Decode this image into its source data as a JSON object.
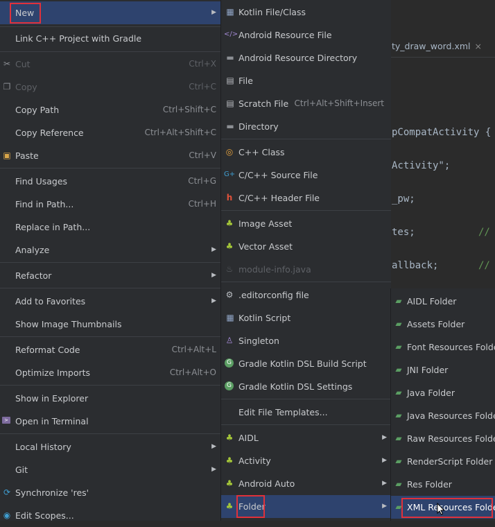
{
  "editor": {
    "tab": "ty_draw_word.xml",
    "tab_close": "×",
    "lines": [
      {
        "text": "pCompatActivity {",
        "comment": ""
      },
      {
        "text": "Activity\";",
        "comment": ""
      },
      {
        "text": "_pw;",
        "comment": ""
      },
      {
        "text": "tes;",
        "comment": "//"
      },
      {
        "text": "allback;",
        "comment": "//"
      }
    ]
  },
  "menu1": {
    "items": [
      {
        "label": "New",
        "arrow": "▶"
      },
      {
        "label": "Link C++ Project with Gradle"
      },
      {
        "label": "Cut",
        "shortcut": "Ctrl+X"
      },
      {
        "label": "Copy",
        "shortcut": "Ctrl+C"
      },
      {
        "label": "Copy Path",
        "shortcut": "Ctrl+Shift+C"
      },
      {
        "label": "Copy Reference",
        "shortcut": "Ctrl+Alt+Shift+C"
      },
      {
        "label": "Paste",
        "shortcut": "Ctrl+V"
      },
      {
        "label": "Find Usages",
        "shortcut": "Ctrl+G"
      },
      {
        "label": "Find in Path...",
        "shortcut": "Ctrl+H"
      },
      {
        "label": "Replace in Path..."
      },
      {
        "label": "Analyze",
        "arrow": "▶"
      },
      {
        "label": "Refactor",
        "arrow": "▶"
      },
      {
        "label": "Add to Favorites",
        "arrow": "▶"
      },
      {
        "label": "Show Image Thumbnails"
      },
      {
        "label": "Reformat Code",
        "shortcut": "Ctrl+Alt+L"
      },
      {
        "label": "Optimize Imports",
        "shortcut": "Ctrl+Alt+O"
      },
      {
        "label": "Show in Explorer"
      },
      {
        "label": "Open in Terminal"
      },
      {
        "label": "Local History",
        "arrow": "▶"
      },
      {
        "label": "Git",
        "arrow": "▶"
      },
      {
        "label": "Synchronize 'res'"
      },
      {
        "label": "Edit Scopes..."
      }
    ]
  },
  "menu2": {
    "items": [
      {
        "label": "Kotlin File/Class"
      },
      {
        "label": "Android Resource File"
      },
      {
        "label": "Android Resource Directory"
      },
      {
        "label": "File"
      },
      {
        "label": "Scratch File",
        "shortcut": "Ctrl+Alt+Shift+Insert"
      },
      {
        "label": "Directory"
      },
      {
        "label": "C++ Class"
      },
      {
        "label": "C/C++ Source File"
      },
      {
        "label": "C/C++ Header File"
      },
      {
        "label": "Image Asset"
      },
      {
        "label": "Vector Asset"
      },
      {
        "label": "module-info.java"
      },
      {
        "label": ".editorconfig file"
      },
      {
        "label": "Kotlin Script"
      },
      {
        "label": "Singleton"
      },
      {
        "label": "Gradle Kotlin DSL Build Script"
      },
      {
        "label": "Gradle Kotlin DSL Settings"
      },
      {
        "label": "Edit File Templates..."
      },
      {
        "label": "AIDL",
        "arrow": "▶"
      },
      {
        "label": "Activity",
        "arrow": "▶"
      },
      {
        "label": "Android Auto",
        "arrow": "▶"
      },
      {
        "label": "Folder",
        "arrow": "▶"
      }
    ]
  },
  "menu3": {
    "items": [
      {
        "label": "AIDL Folder"
      },
      {
        "label": "Assets Folder"
      },
      {
        "label": "Font Resources Folder"
      },
      {
        "label": "JNI Folder"
      },
      {
        "label": "Java Folder"
      },
      {
        "label": "Java Resources Folder"
      },
      {
        "label": "Raw Resources Folder"
      },
      {
        "label": "RenderScript Folder"
      },
      {
        "label": "Res Folder"
      },
      {
        "label": "XML Resources Folder"
      }
    ]
  },
  "colors": {
    "menu_bg": "#2b2d30",
    "selection_bg": "#2e436e",
    "highlight_border": "#e0313a",
    "android_green": "#a4c639",
    "folder_green": "#5b9e63"
  }
}
